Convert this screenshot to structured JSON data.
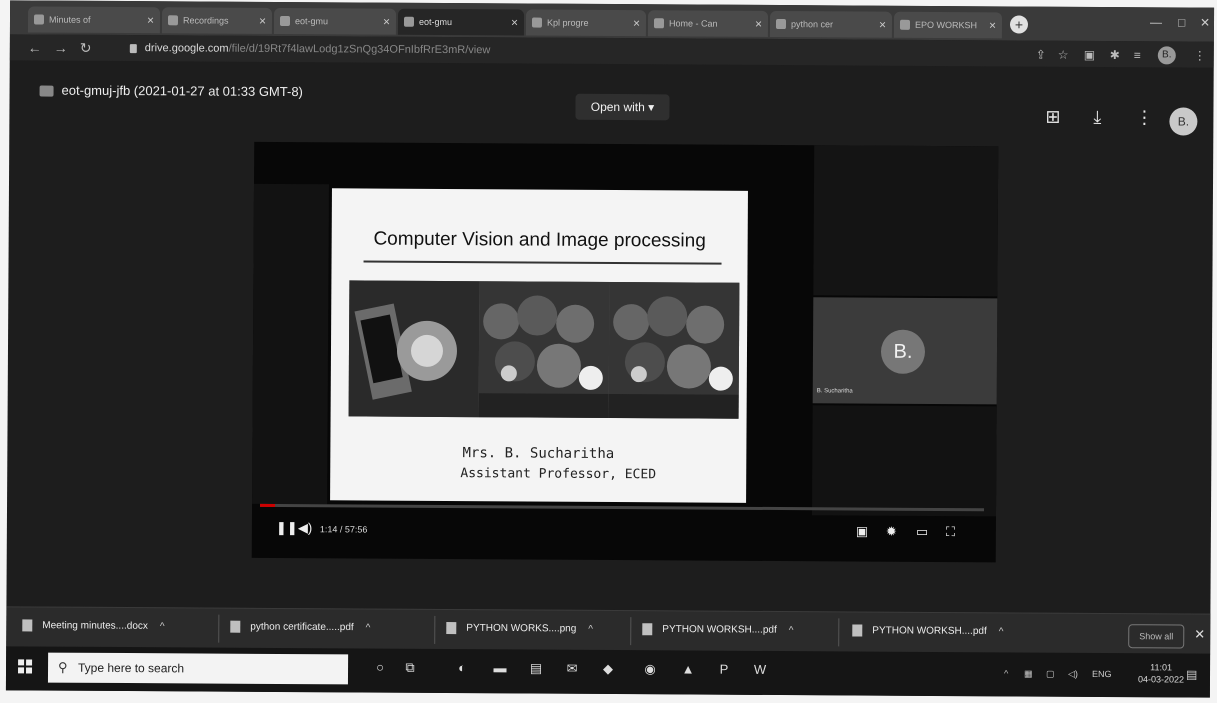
{
  "tabs": [
    {
      "label": "Minutes of"
    },
    {
      "label": "Recordings"
    },
    {
      "label": "eot-gmu"
    },
    {
      "label": "eot-gmu",
      "active": true
    },
    {
      "label": "Kpl progre"
    },
    {
      "label": "Home - Can"
    },
    {
      "label": "python cer"
    },
    {
      "label": "EPO WORKSH"
    }
  ],
  "address": {
    "domain": "drive.google.com",
    "path": "/file/d/19Rt7f4lawLodg1zSnQg34OFnIbfRrE3mR/view"
  },
  "drive": {
    "file_title": "eot-gmuj-jfb (2021-01-27 at 01:33 GMT-8)",
    "open_with": "Open with",
    "avatar": "B."
  },
  "slide": {
    "title": "Computer Vision and  Image processing",
    "author": "Mrs. B. Sucharitha",
    "role": "Assistant Professor, ECED"
  },
  "participant": {
    "avatar": "B.",
    "name": "B. Sucharitha"
  },
  "player": {
    "timecode": "1:14 / 57:56",
    "progress": 0.021
  },
  "downloads": [
    {
      "name": "Meeting minutes....docx"
    },
    {
      "name": "python certificate.....pdf"
    },
    {
      "name": "PYTHON WORKS....png"
    },
    {
      "name": "PYTHON WORKSH....pdf"
    },
    {
      "name": "PYTHON WORKSH....pdf"
    }
  ],
  "downloads_show_all": "Show all",
  "taskbar": {
    "search_placeholder": "Type here to search",
    "lang": "ENG",
    "time": "11:01",
    "date": "04-03-2022"
  }
}
